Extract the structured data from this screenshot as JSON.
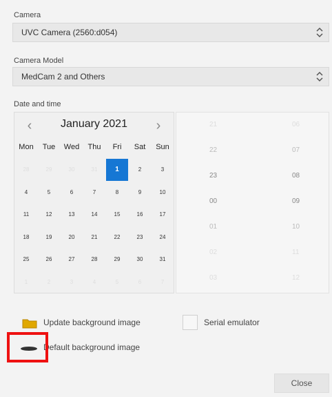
{
  "camera": {
    "label": "Camera",
    "value": "UVC Camera (2560:d054)"
  },
  "camera_model": {
    "label": "Camera Model",
    "value": "MedCam 2 and Others"
  },
  "datetime": {
    "label": "Date and time",
    "month_label": "January 2021",
    "weekdays": [
      "Mon",
      "Tue",
      "Wed",
      "Thu",
      "Fri",
      "Sat",
      "Sun"
    ],
    "weeks": [
      [
        "28",
        "29",
        "30",
        "31",
        "1",
        "2",
        "3"
      ],
      [
        "4",
        "5",
        "6",
        "7",
        "8",
        "9",
        "10"
      ],
      [
        "11",
        "12",
        "13",
        "14",
        "15",
        "16",
        "17"
      ],
      [
        "18",
        "19",
        "20",
        "21",
        "22",
        "23",
        "24"
      ],
      [
        "25",
        "26",
        "27",
        "28",
        "29",
        "30",
        "31"
      ],
      [
        "1",
        "2",
        "3",
        "4",
        "5",
        "6",
        "7"
      ]
    ],
    "selected_day": "1",
    "hours": [
      "21",
      "22",
      "23",
      "00",
      "01",
      "02",
      "03"
    ],
    "minutes": [
      "06",
      "07",
      "08",
      "09",
      "10",
      "11",
      "12"
    ]
  },
  "options": {
    "update_bg": "Update background image",
    "default_bg": "Default background image",
    "serial_emulator": "Serial emulator"
  },
  "footer": {
    "close": "Close"
  }
}
